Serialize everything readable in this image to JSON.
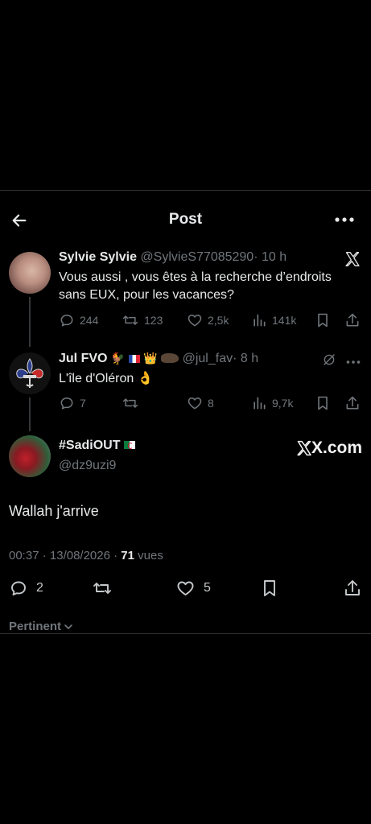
{
  "header": {
    "title": "Post"
  },
  "thread": [
    {
      "name": "Sylvie Sylvie",
      "handle": "@SylvieS77085290",
      "time": "· 10 h",
      "text_line1": "Vous aussi , vous êtes à la recherche d’endroits",
      "text_line2": "sans EUX, pour les vacances?",
      "replies": "244",
      "reposts": "123",
      "likes": "2,5k",
      "views": "141k"
    },
    {
      "name": "Jul FVO",
      "name_emojis": "🐓",
      "name_emojis2": "👑",
      "handle": "@jul_fav",
      "time": "· 8 h",
      "text": "L'île d'Oléron 👌",
      "replies": "7",
      "reposts": "",
      "likes": "8",
      "views": "9,7k"
    }
  ],
  "main_post": {
    "name": "#SadiOUT",
    "handle": "@dz9uzi9",
    "watermark": "X.com",
    "text": "Wallah j'arrive",
    "time": "00:37",
    "date": "· 13/08/2026 ·",
    "views_count": "71",
    "views_label": "vues",
    "replies": "2",
    "reposts": "",
    "likes": "5"
  },
  "sort": {
    "label": "Pertinent"
  },
  "colors": {
    "background": "#000000",
    "text": "#e7e9ea",
    "muted": "#71767b",
    "divider": "#2f3336"
  }
}
